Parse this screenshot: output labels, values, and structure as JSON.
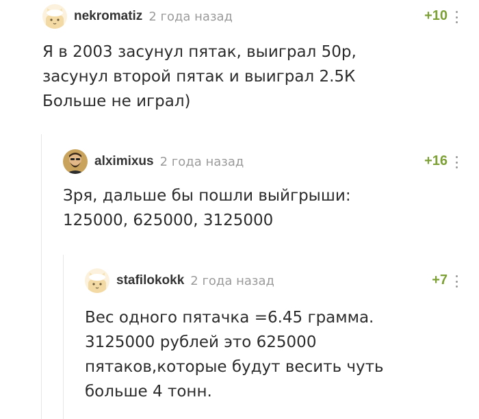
{
  "comments": [
    {
      "username": "nekromatiz",
      "time": "2 года назад",
      "rating": "+10",
      "text": "Я в 2003 засунул пятак, выиграл 50р,\nзасунул второй пятак и выиграл 2.5К\nБольше не играл)",
      "avatar_icon": "default-cat-avatar"
    },
    {
      "username": "alximixus",
      "time": "2 года назад",
      "rating": "+16",
      "text": "Зря, дальше бы пошли выйгрыши:\n125000, 625000, 3125000",
      "avatar_icon": "bearded-man-avatar"
    },
    {
      "username": "stafilokokk",
      "time": "2 года назад",
      "rating": "+7",
      "text": "Вес одного пятачка =6.45 грамма.\n3125000 рублей это 625000\nпятаков,которые будут весить чуть\nбольше 4 тонн.",
      "avatar_icon": "default-cat-avatar"
    }
  ],
  "colors": {
    "rating_positive": "#7ca034",
    "time_gray": "#9a9a9a",
    "thread_line": "#e6e6e6"
  }
}
